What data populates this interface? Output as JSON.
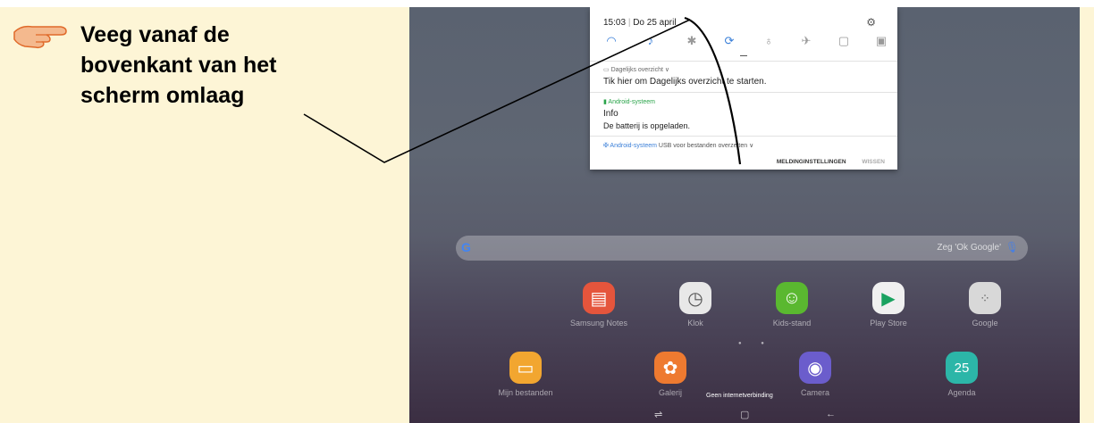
{
  "instruction": {
    "lines": [
      "Veeg vanaf de",
      "bovenkant van het",
      "scherm omlaag"
    ]
  },
  "notification_panel": {
    "time": "15:03",
    "date": "Do 25 april",
    "separator": "|",
    "daily": {
      "header": "Dagelijks overzicht ∨",
      "body": "Tik hier om Dagelijks overzicht te starten."
    },
    "system": {
      "header": "Android-systeem",
      "title": "Info",
      "body": "De batterij is opgeladen."
    },
    "usb": {
      "app": "✠ Android-systeem",
      "text": "USB voor bestanden overzetten ∨"
    },
    "buttons": {
      "settings": "MELDINGINSTELLINGEN",
      "clear": "WISSEN"
    }
  },
  "search_bar": {
    "logo": "G",
    "hint": "Zeg 'Ok Google'"
  },
  "apps_row1": [
    {
      "label": "Samsung Notes",
      "icon": "samsung-notes-icon",
      "color": "#e5553c"
    },
    {
      "label": "Klok",
      "icon": "clock-icon",
      "color": "#e8e8e8"
    },
    {
      "label": "Kids-stand",
      "icon": "kids-mode-icon",
      "color": "#5ab830"
    },
    {
      "label": "Play Store",
      "icon": "play-store-icon",
      "color": "#f0f0f0"
    },
    {
      "label": "Google",
      "icon": "google-folder-icon",
      "color": "#d8d8d8"
    }
  ],
  "apps_row2": [
    {
      "label": "Mijn bestanden",
      "icon": "folder-icon",
      "color": "#f2a630"
    },
    {
      "label": "Galerij",
      "icon": "gallery-icon",
      "color": "#ee7a30"
    },
    {
      "label": "Camera",
      "icon": "camera-icon",
      "color": "#6b5dcc"
    },
    {
      "label": "Agenda",
      "icon": "calendar-icon",
      "color": "#2cb6a8"
    }
  ],
  "toast": "Geen internetverbinding",
  "calendar_day": "25",
  "colors": {
    "instruction_bg": "#fdf5d6",
    "accent_blue": "#3a7fd8",
    "system_green": "#2aa44a"
  }
}
